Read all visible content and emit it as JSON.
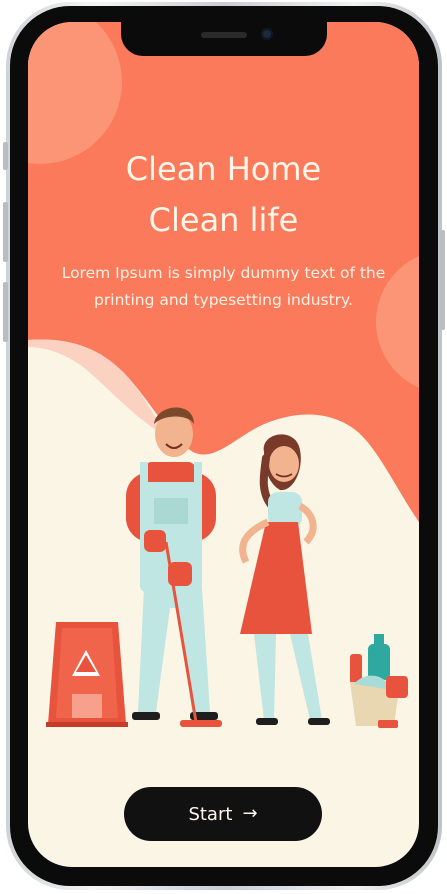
{
  "onboarding": {
    "title_line1": "Clean Home",
    "title_line2": "Clean life",
    "subtitle": "Lorem Ipsum is simply dummy text of the printing and typesetting industry.",
    "start_label": "Start",
    "start_icon": "arrow-right-icon"
  },
  "colors": {
    "accent": "#fa7a5b",
    "background": "#fbf5e6",
    "button": "#111111"
  }
}
